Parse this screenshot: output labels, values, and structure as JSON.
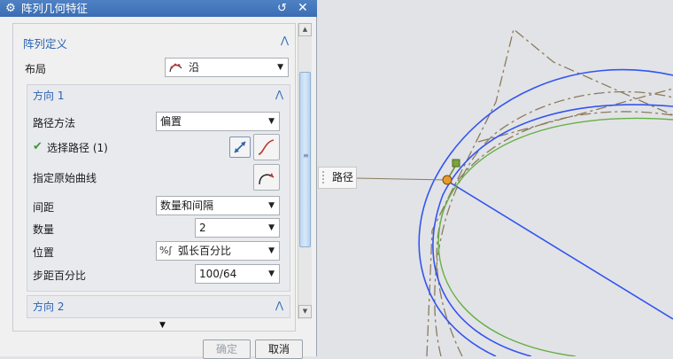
{
  "dialog": {
    "title": "阵列几何特征",
    "title_icon": "gear-icon",
    "reset_icon": "reset-icon",
    "close_icon": "close-icon"
  },
  "array_definition": {
    "header": "阵列定义",
    "layout_label": "布局",
    "layout_value": "沿"
  },
  "direction1": {
    "header": "方向 1",
    "path_method_label": "路径方法",
    "path_method_value": "偏置",
    "select_path_label": "选择路径 (1)",
    "specify_curve_label": "指定原始曲线",
    "spacing_label": "间距",
    "spacing_value": "数量和间隔",
    "count_label": "数量",
    "count_value": "2",
    "position_label": "位置",
    "position_value": "弧长百分比",
    "step_label": "步距百分比",
    "step_value": "100/64"
  },
  "direction2": {
    "header": "方向 2"
  },
  "footer": {
    "ok_label": "确定",
    "cancel_label": "取消"
  },
  "viewport": {
    "path_label": "路径"
  },
  "colors": {
    "title_bar": "#3f73b8",
    "group_header": "#2a62b0",
    "curve_blue": "#3355ee",
    "curve_green": "#66b044",
    "curve_dashed": "#8a7b5c"
  }
}
